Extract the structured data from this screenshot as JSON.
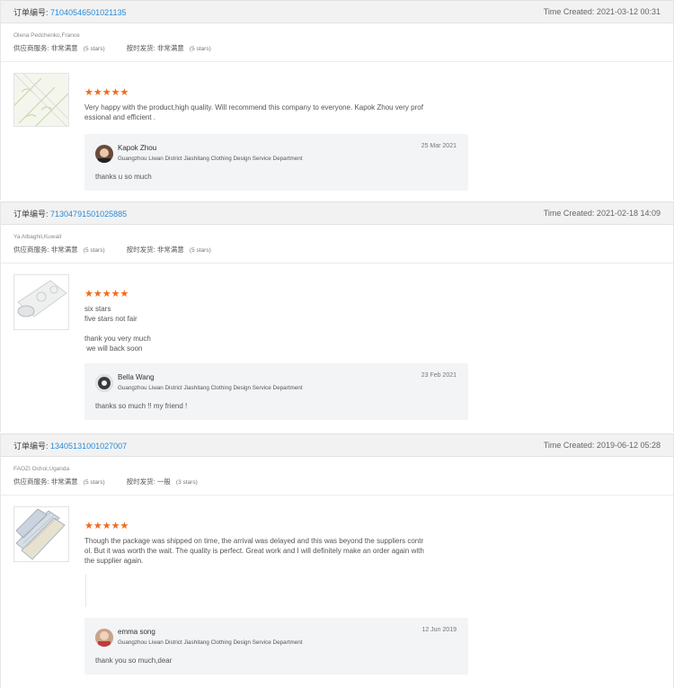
{
  "colors": {
    "accent_link": "#2a8ad6",
    "star": "#f26a1b",
    "header_bg": "#f2f2f2",
    "reply_bg": "#f3f4f6"
  },
  "orders": [
    {
      "order_label": "订单编号:",
      "order_no": "71040546501021135",
      "time_created": "Time Created: 2021-03-12 00:31",
      "buyer": "Olena Pedchenko,France",
      "supplier_label": "供应商服务:",
      "supplier_value": "非常满意",
      "supplier_stars": "(5 stars)",
      "shipping_label": "按时发货:",
      "shipping_value": "非常满意",
      "shipping_stars": "(5 stars)",
      "rating_stars": "★★★★★",
      "review": "Very happy with the product,high quality. Will recommend this company to everyone. Kapok Zhou very prof\nessional and efficient .",
      "reply": {
        "name": "Kapok Zhou",
        "company": "Guangzhou Liwan District Jiashitang Clothing Design Service Department",
        "date": "25 Mar 2021",
        "message": "thanks u so much"
      }
    },
    {
      "order_label": "订单编号:",
      "order_no": "71304791501025885",
      "time_created": "Time Created: 2021-02-18 14:09",
      "buyer": "Ya Albaghli,Kuwait",
      "supplier_label": "供应商服务:",
      "supplier_value": "非常满意",
      "supplier_stars": "(5 stars)",
      "shipping_label": "按时发货:",
      "shipping_value": "非常满意",
      "shipping_stars": "(5 stars)",
      "rating_stars": "★★★★★",
      "review": "six stars\nfive stars not fair\n\nthank you very much\n we will back soon",
      "reply": {
        "name": "Bella Wang",
        "company": "Guangzhou Liwan District Jiashitang Clothing Design Service Department",
        "date": "23 Feb 2021",
        "message": "thanks so much !! my friend !"
      }
    },
    {
      "order_label": "订单编号:",
      "order_no": "13405131001027007",
      "time_created": "Time Created: 2019-06-12 05:28",
      "buyer": "FAOZI Ochol,Uganda",
      "supplier_label": "供应商服务:",
      "supplier_value": "非常满意",
      "supplier_stars": "(5 stars)",
      "shipping_label": "按时发货:",
      "shipping_value": "一般",
      "shipping_stars": "(3 stars)",
      "rating_stars": "★★★★★",
      "review": "Though the package was shipped on time, the arrival was delayed and this was beyond the suppliers contr\nol. But it was worth the wait. The quality is perfect. Great work and I will definitely make an order again with\nthe supplier again.",
      "reply": {
        "name": "emma song",
        "company": "Guangzhou Liwan District Jiashitang Clothing Design Service Department",
        "date": "12 Jun 2019",
        "message": "thank you so much,dear"
      }
    }
  ]
}
